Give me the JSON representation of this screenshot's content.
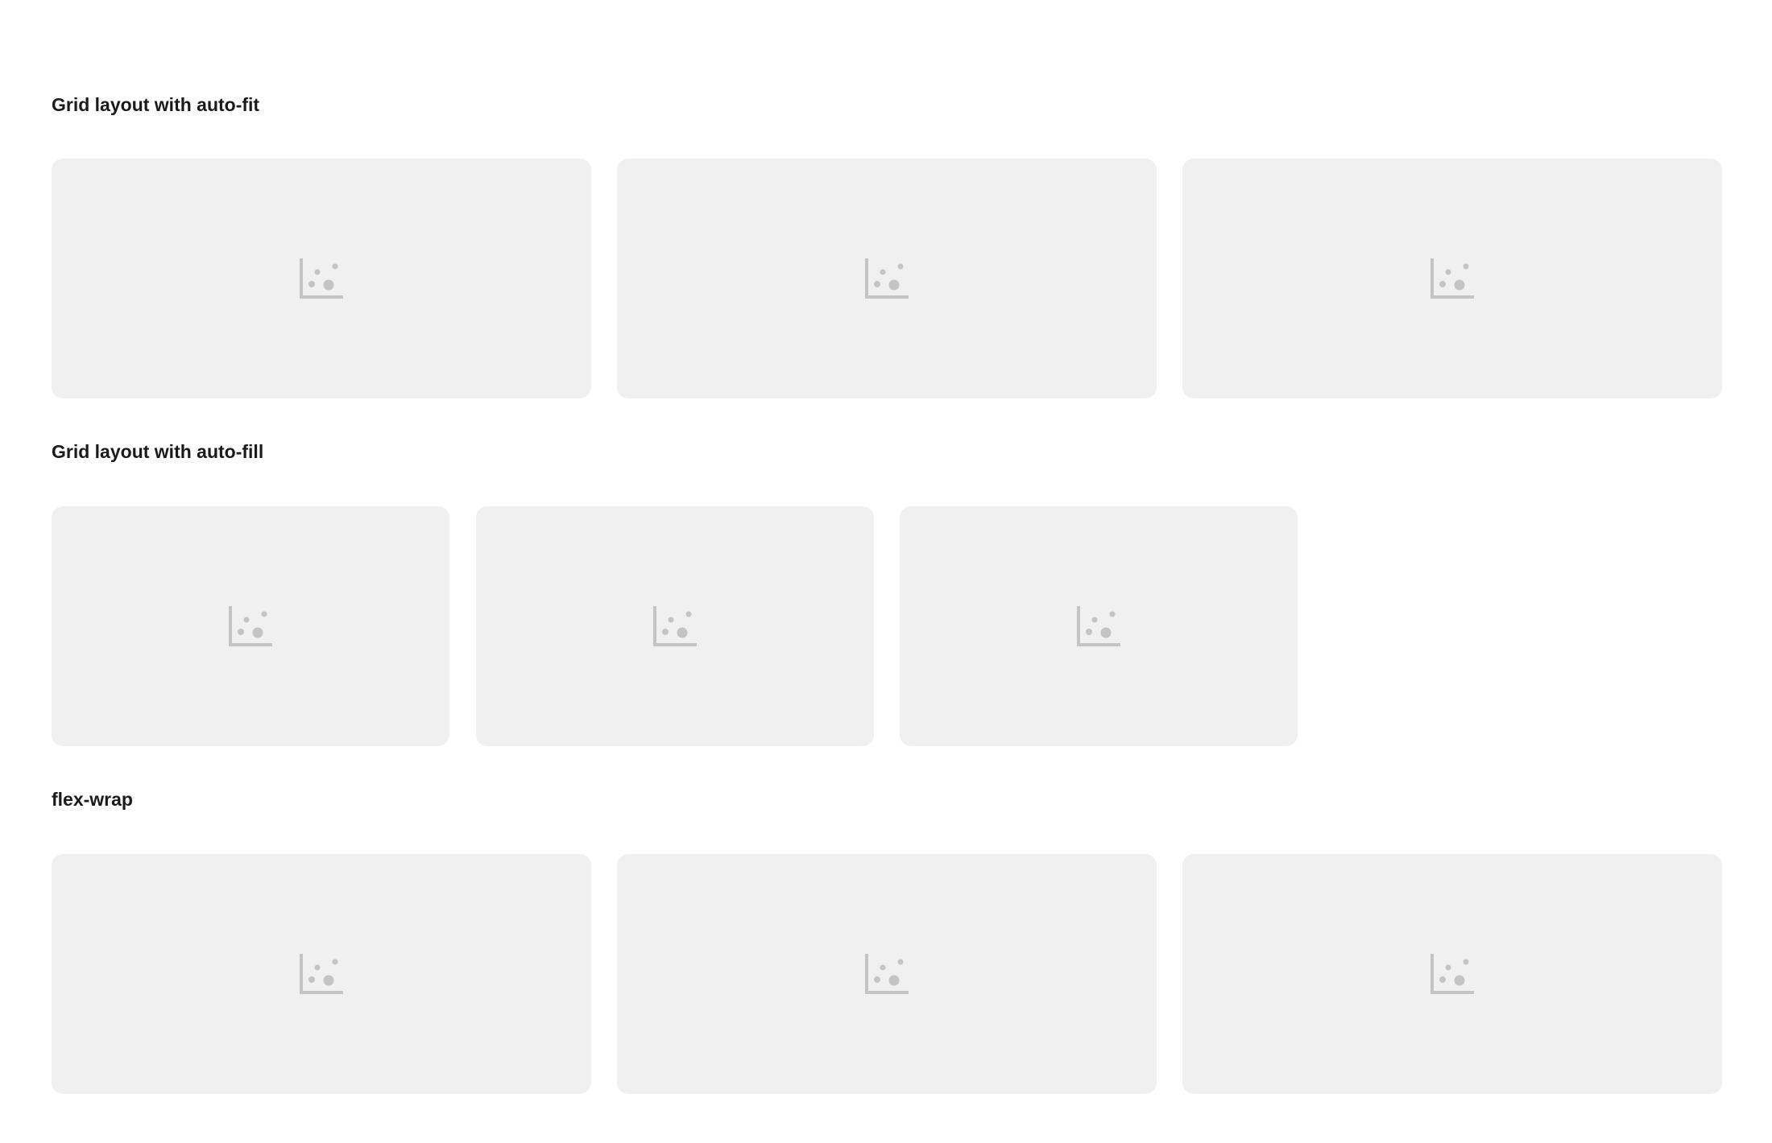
{
  "sections": [
    {
      "title": "Grid layout with auto-fit",
      "cards": [
        {
          "icon": "scatter-chart-icon"
        },
        {
          "icon": "scatter-chart-icon"
        },
        {
          "icon": "scatter-chart-icon"
        }
      ]
    },
    {
      "title": "Grid layout with auto-fill",
      "cards": [
        {
          "icon": "scatter-chart-icon"
        },
        {
          "icon": "scatter-chart-icon"
        },
        {
          "icon": "scatter-chart-icon"
        }
      ]
    },
    {
      "title": "flex-wrap",
      "cards": [
        {
          "icon": "scatter-chart-icon"
        },
        {
          "icon": "scatter-chart-icon"
        },
        {
          "icon": "scatter-chart-icon"
        }
      ]
    }
  ],
  "colors": {
    "card_background": "#f0f0f0",
    "icon": "#c4c4c4",
    "title_text": "#1a1a1a"
  }
}
